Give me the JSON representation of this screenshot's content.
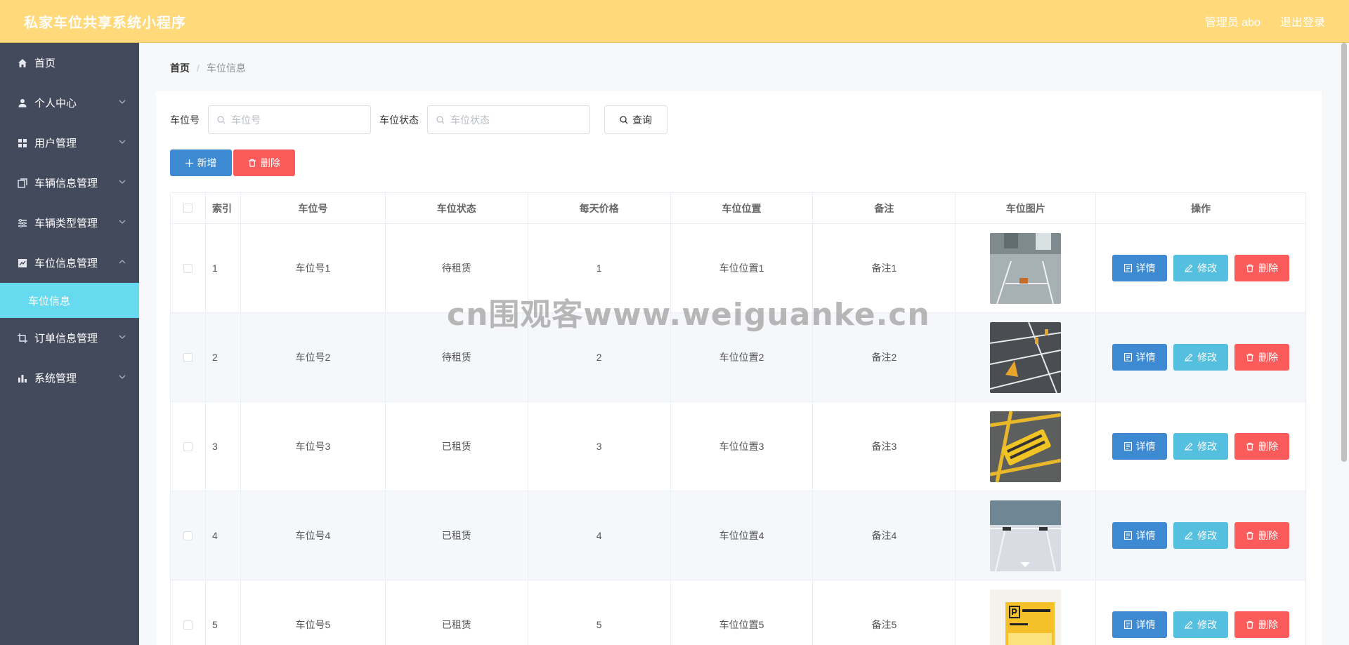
{
  "header": {
    "app_title": "私家车位共享系统小程序",
    "user_label": "管理员 abo",
    "logout_label": "退出登录"
  },
  "sidebar": {
    "items": [
      {
        "label": "首页",
        "icon": "home-icon"
      },
      {
        "label": "个人中心",
        "icon": "user-icon"
      },
      {
        "label": "用户管理",
        "icon": "grid-icon"
      },
      {
        "label": "车辆信息管理",
        "icon": "copy-icon"
      },
      {
        "label": "车辆类型管理",
        "icon": "list-icon"
      },
      {
        "label": "车位信息管理",
        "icon": "chart-icon"
      },
      {
        "label": "订单信息管理",
        "icon": "crop-icon"
      },
      {
        "label": "系统管理",
        "icon": "bar-chart-icon"
      }
    ],
    "active_sub": "车位信息"
  },
  "breadcrumb": {
    "home": "首页",
    "separator": "/",
    "current": "车位信息"
  },
  "search": {
    "field1_label": "车位号",
    "field1_placeholder": "车位号",
    "field2_label": "车位状态",
    "field2_placeholder": "车位状态",
    "query_label": "查询"
  },
  "actions": {
    "add_label": "新增",
    "delete_label": "删除"
  },
  "table": {
    "headers": [
      "索引",
      "车位号",
      "车位状态",
      "每天价格",
      "车位位置",
      "备注",
      "车位图片",
      "操作"
    ],
    "rows": [
      {
        "idx": "1",
        "num": "车位号1",
        "status": "待租赁",
        "price": "1",
        "location": "车位位置1",
        "note": "备注1"
      },
      {
        "idx": "2",
        "num": "车位号2",
        "status": "待租赁",
        "price": "2",
        "location": "车位位置2",
        "note": "备注2"
      },
      {
        "idx": "3",
        "num": "车位号3",
        "status": "已租赁",
        "price": "3",
        "location": "车位位置3",
        "note": "备注3"
      },
      {
        "idx": "4",
        "num": "车位号4",
        "status": "已租赁",
        "price": "4",
        "location": "车位位置4",
        "note": "备注4"
      },
      {
        "idx": "5",
        "num": "车位号5",
        "status": "已租赁",
        "price": "5",
        "location": "车位位置5",
        "note": "备注5"
      }
    ],
    "row_actions": {
      "detail": "详情",
      "edit": "修改",
      "delete": "删除"
    }
  },
  "watermark": "cn围观客www.weiguanke.cn",
  "colors": {
    "header_bg": "#ffd97a",
    "sidebar_bg": "#434a5c",
    "active_sub_bg": "#66dbef",
    "primary": "#3d8ad3",
    "info": "#55bfe0",
    "danger": "#fb5b5b"
  }
}
